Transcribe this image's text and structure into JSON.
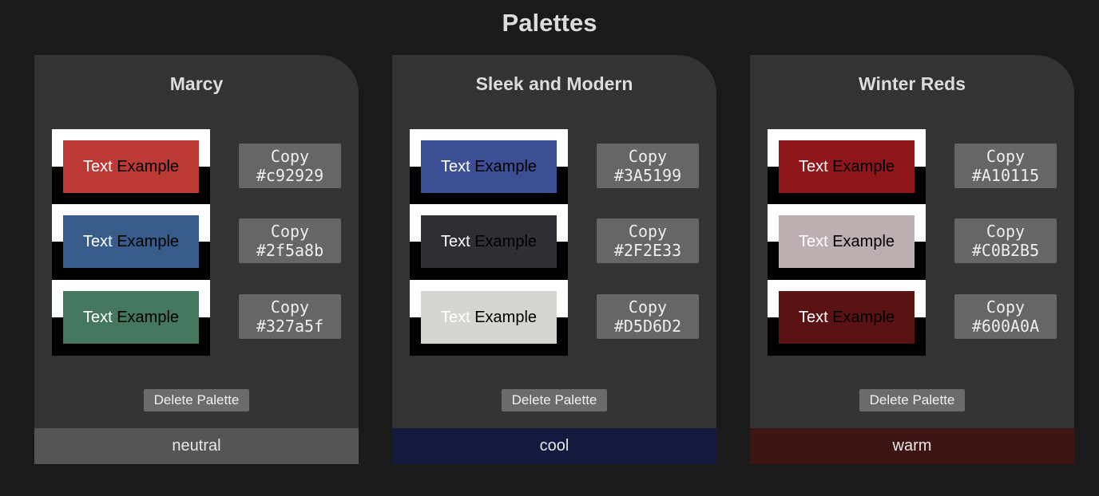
{
  "page": {
    "title": "Palettes"
  },
  "palettes": [
    {
      "name": "Marcy",
      "category": "neutral",
      "category_color": "#555555",
      "delete_label": "Delete Palette",
      "colors": [
        {
          "hex": "#c92929",
          "swatch": "#bb3a35",
          "copy_label": "Copy",
          "text_word": "Text",
          "example_word": "Example"
        },
        {
          "hex": "#2f5a8b",
          "swatch": "#385c8a",
          "copy_label": "Copy",
          "text_word": "Text",
          "example_word": "Example"
        },
        {
          "hex": "#327a5f",
          "swatch": "#44775e",
          "copy_label": "Copy",
          "text_word": "Text",
          "example_word": "Example"
        }
      ]
    },
    {
      "name": "Sleek and Modern",
      "category": "cool",
      "category_color": "#141a3d",
      "delete_label": "Delete Palette",
      "colors": [
        {
          "hex": "#3A5199",
          "swatch": "#3c4f94",
          "copy_label": "Copy",
          "text_word": "Text",
          "example_word": "Example"
        },
        {
          "hex": "#2F2E33",
          "swatch": "#2f2e33",
          "copy_label": "Copy",
          "text_word": "Text",
          "example_word": "Example"
        },
        {
          "hex": "#D5D6D2",
          "swatch": "#d5d6d2",
          "copy_label": "Copy",
          "text_word": "Text",
          "example_word": "Example"
        }
      ]
    },
    {
      "name": "Winter Reds",
      "category": "warm",
      "category_color": "#3d1515",
      "delete_label": "Delete Palette",
      "colors": [
        {
          "hex": "#A10115",
          "swatch": "#8f161b",
          "copy_label": "Copy",
          "text_word": "Text",
          "example_word": "Example"
        },
        {
          "hex": "#C0B2B5",
          "swatch": "#bbafb1",
          "copy_label": "Copy",
          "text_word": "Text",
          "example_word": "Example"
        },
        {
          "hex": "#600A0A",
          "swatch": "#5a1312",
          "copy_label": "Copy",
          "text_word": "Text",
          "example_word": "Example"
        }
      ]
    }
  ]
}
